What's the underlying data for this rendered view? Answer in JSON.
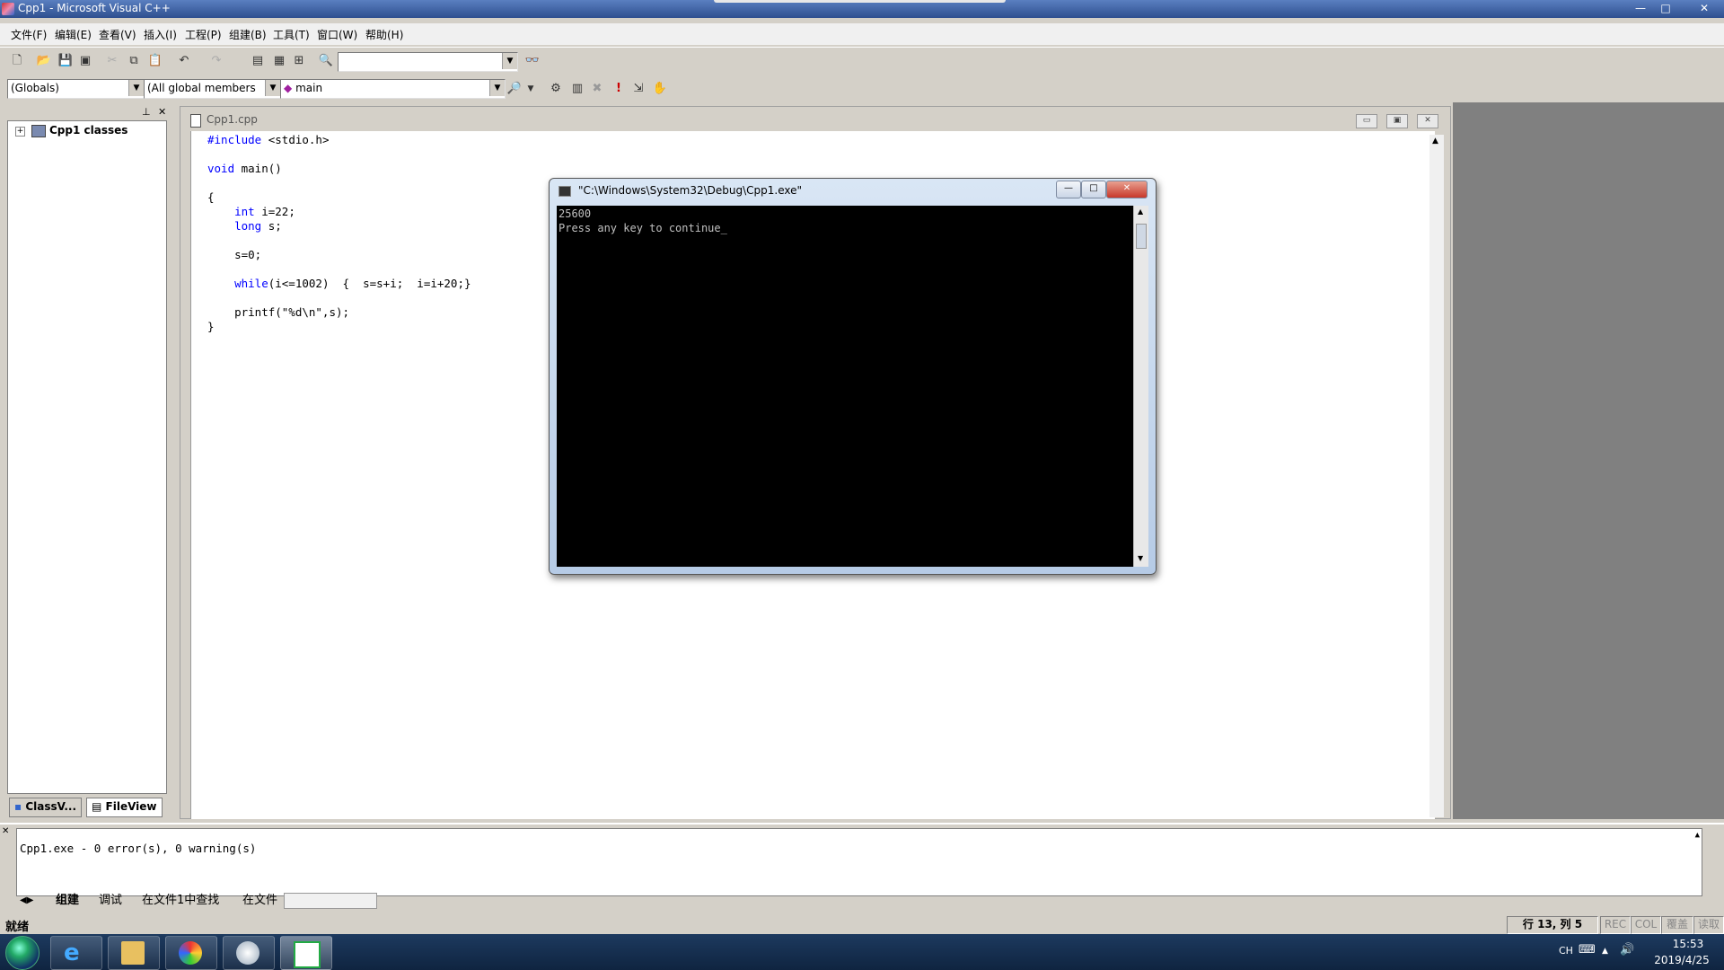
{
  "window": {
    "title": "Cpp1 - Microsoft Visual C++"
  },
  "menu": [
    "文件(F)",
    "编辑(E)",
    "查看(V)",
    "插入(I)",
    "工程(P)",
    "组建(B)",
    "工具(T)",
    "窗口(W)",
    "帮助(H)"
  ],
  "wizardbar": {
    "scope": "(Globals)",
    "members": "(All global members",
    "function": "main"
  },
  "workspace": {
    "tree_root": "Cpp1 classes",
    "tabs": [
      "ClassV...",
      "FileView"
    ]
  },
  "editor": {
    "file_title": "Cpp1.cpp",
    "code": [
      {
        "kw": "#include",
        "rest": " <stdio.h>"
      },
      {
        "kw": "void",
        "rest": " main()"
      },
      {
        "kw": "",
        "rest": "{"
      },
      {
        "kw": "    int",
        "rest": " i=22;"
      },
      {
        "kw": "    long",
        "rest": " s;"
      },
      {
        "kw": "",
        "rest": "    s=0;"
      },
      {
        "kw": "    while",
        "rest": "(i<=1002)  {  s=s+i;  i=i+20;}"
      },
      {
        "kw": "",
        "rest": "    printf(\"%d\\n\",s);"
      },
      {
        "kw": "",
        "rest": "}"
      }
    ]
  },
  "console": {
    "title": "\"C:\\Windows\\System32\\Debug\\Cpp1.exe\"",
    "lines": [
      "25600",
      "Press any key to continue_"
    ]
  },
  "output": {
    "text": "Cpp1.exe - 0 error(s), 0 warning(s)",
    "tabs": [
      "组建",
      "调试",
      "在文件1中查找",
      "在文件"
    ]
  },
  "status": {
    "text": "就绪",
    "position": "行 13, 列 5",
    "panes": [
      "REC",
      "COL",
      "覆盖",
      "读取"
    ]
  },
  "taskbar": {
    "lang": "CH",
    "time": "15:53",
    "date": "2019/4/25"
  }
}
